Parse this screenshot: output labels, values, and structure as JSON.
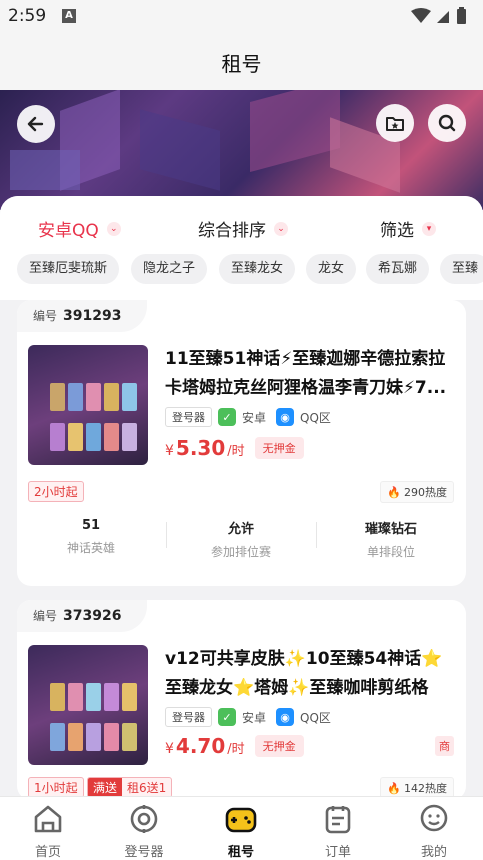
{
  "status_bar": {
    "time": "2:59",
    "notif_letter": "A"
  },
  "header": {
    "title": "租号"
  },
  "filters": [
    {
      "label": "安卓QQ",
      "color": "#e8344c"
    },
    {
      "label": "综合排序",
      "color": "#333333"
    },
    {
      "label": "筛选",
      "color": "#333333"
    }
  ],
  "chips": [
    "至臻厄斐琉斯",
    "隐龙之子",
    "至臻龙女",
    "龙女",
    "希瓦娜",
    "至臻"
  ],
  "listings": [
    {
      "id_label": "编号",
      "id": "391293",
      "title": "11至臻51神话⚡至臻迦娜辛德拉索拉卡塔姆拉克丝阿狸格温李青刀妹⚡7...",
      "launcher": "登号器",
      "os": "安卓",
      "region": "QQ区",
      "price_symbol": "¥",
      "price": "5.30",
      "price_unit": "/时",
      "deposit": "无押金",
      "min_rent": "2小时起",
      "heat": "290热度",
      "stats": [
        {
          "value": "51",
          "label": "神话英雄"
        },
        {
          "value": "允许",
          "label": "参加排位赛"
        },
        {
          "value": "璀璨钻石",
          "label": "单排段位"
        }
      ]
    },
    {
      "id_label": "编号",
      "id": "373926",
      "title": "v12可共享皮肤✨10至臻54神话⭐至臻龙女⭐塔姆✨至臻咖啡剪纸格温...",
      "launcher": "登号器",
      "os": "安卓",
      "region": "QQ区",
      "price_symbol": "¥",
      "price": "4.70",
      "price_unit": "/时",
      "deposit": "无押金",
      "shop_tag": "商",
      "min_rent": "1小时起",
      "promo": "满送",
      "promo_detail": "租6送1",
      "heat": "142热度"
    }
  ],
  "tabbar": [
    {
      "label": "首页",
      "icon": "home-icon",
      "active": false
    },
    {
      "label": "登号器",
      "icon": "launcher-icon",
      "active": false
    },
    {
      "label": "租号",
      "icon": "gamepad-icon",
      "active": true
    },
    {
      "label": "订单",
      "icon": "order-icon",
      "active": false
    },
    {
      "label": "我的",
      "icon": "profile-icon",
      "active": false
    }
  ]
}
